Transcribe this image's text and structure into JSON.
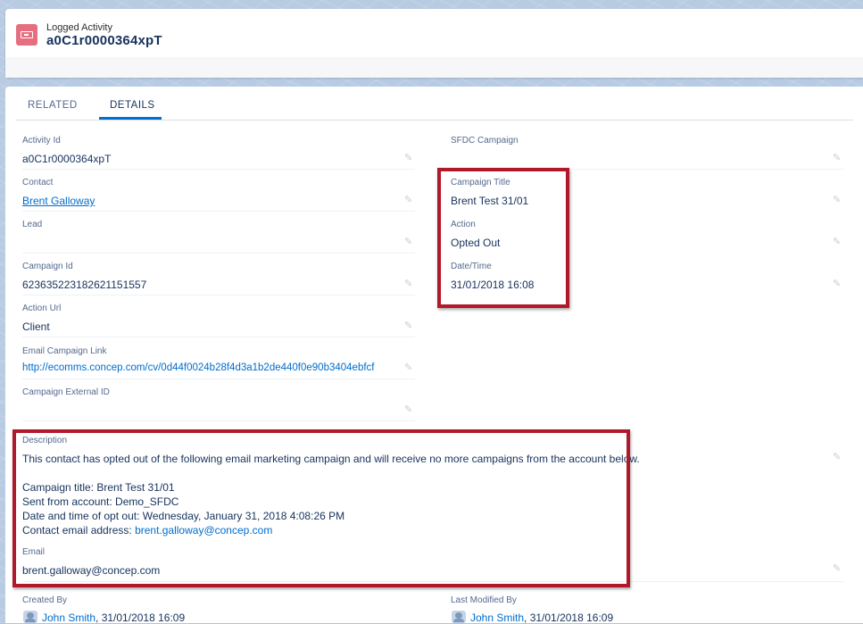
{
  "header": {
    "object_type": "Logged Activity",
    "record_name": "a0C1r0000364xpT"
  },
  "tabs": [
    {
      "label": "RELATED",
      "active": false
    },
    {
      "label": "DETAILS",
      "active": true
    }
  ],
  "left_fields": {
    "activity_id": {
      "label": "Activity Id",
      "value": "a0C1r0000364xpT"
    },
    "contact": {
      "label": "Contact",
      "value": "Brent Galloway"
    },
    "lead": {
      "label": "Lead",
      "value": ""
    },
    "campaign_id": {
      "label": "Campaign Id",
      "value": "62363522318262115155 7"
    },
    "action_url": {
      "label": "Action Url",
      "value": "Client"
    },
    "email_campaign_link": {
      "label": "Email Campaign Link",
      "value": "http://ecomms.concep.com/cv/0d44f0024b28f4d3a1b2de440f0e90b3404ebfcf"
    },
    "campaign_external_id": {
      "label": "Campaign External ID",
      "value": ""
    }
  },
  "right_fields": {
    "sfdc_campaign": {
      "label": "SFDC Campaign",
      "value": ""
    },
    "campaign_title": {
      "label": "Campaign Title",
      "value": "Brent Test 31/01"
    },
    "action": {
      "label": "Action",
      "value": "Opted Out"
    },
    "date_time": {
      "label": "Date/Time",
      "value": "31/01/2018 16:08"
    }
  },
  "description": {
    "label": "Description",
    "line1": "This contact has opted out of the following email marketing campaign and will receive no more campaigns from the account below.",
    "line2": "Campaign title: Brent Test 31/01",
    "line3": "Sent from account: Demo_SFDC",
    "line4": "Date and time of opt out: Wednesday, January 31, 2018 4:08:26 PM",
    "line5_prefix": "Contact email address: ",
    "line5_email": "brent.galloway@concep.com"
  },
  "email": {
    "label": "Email",
    "value": "brent.galloway@concep.com"
  },
  "created_by": {
    "label": "Created By",
    "user": "John Smith",
    "date": ", 31/01/2018 16:09"
  },
  "last_modified_by": {
    "label": "Last Modified By",
    "user": "John Smith",
    "date": ", 31/01/2018 16:09"
  },
  "colors": {
    "link": "#006dcc",
    "highlight": "#b2182b",
    "icon": "#e56f7e",
    "tab_active": "#0070d2"
  },
  "icons": {
    "object": "logged-activity-icon",
    "edit": "pencil-icon",
    "user": "avatar-icon"
  }
}
